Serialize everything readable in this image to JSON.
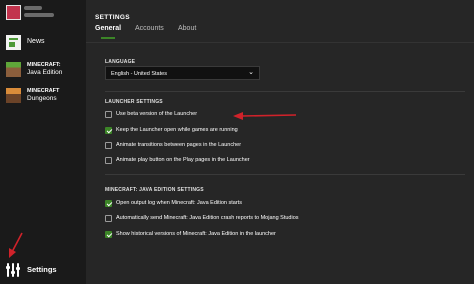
{
  "sidebar": {
    "news_label": "News",
    "java_line1": "MINECRAFT:",
    "java_line2": "Java Edition",
    "dungeons_line1": "MINECRAFT",
    "dungeons_line2": "Dungeons",
    "settings_label": "Settings"
  },
  "main": {
    "title": "SETTINGS",
    "tabs": [
      {
        "label": "General"
      },
      {
        "label": "Accounts"
      },
      {
        "label": "About"
      }
    ]
  },
  "language": {
    "section_title": "LANGUAGE",
    "selected": "English - United States"
  },
  "launcher_settings": {
    "section_title": "LAUNCHER SETTINGS",
    "options": [
      {
        "label": "Use beta version of the Launcher",
        "checked": false
      },
      {
        "label": "Keep the Launcher open while games are running",
        "checked": true
      },
      {
        "label": "Animate transitions between pages in the Launcher",
        "checked": false
      },
      {
        "label": "Animate play button on the Play pages in the Launcher",
        "checked": false
      }
    ]
  },
  "java_settings": {
    "section_title": "MINECRAFT: JAVA EDITION SETTINGS",
    "options": [
      {
        "label": "Open output log when Minecraft: Java Edition starts",
        "checked": true
      },
      {
        "label": "Automatically send Minecraft: Java Edition crash reports to Mojang Studios",
        "checked": false
      },
      {
        "label": "Show historical versions of Minecraft: Java Edition in the launcher",
        "checked": true
      }
    ]
  },
  "colors": {
    "accent": "#3c8527",
    "annotation_arrow": "#d0222a",
    "sidebar_bg": "#1a1a1a",
    "main_bg": "#262626"
  },
  "icons": {
    "news": "news-icon",
    "java": "grass-block-icon",
    "dungeons": "dungeons-icon",
    "settings": "sliders-icon",
    "dropdown": "chevron-down-icon"
  }
}
